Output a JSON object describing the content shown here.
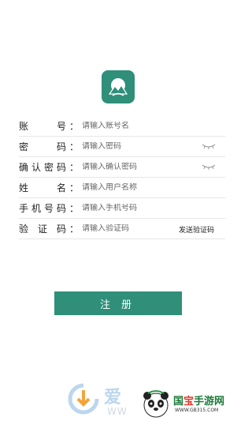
{
  "form": {
    "rows": [
      {
        "label_chars": [
          "账",
          "号"
        ],
        "colon": "：",
        "placeholder": "请输入账号名"
      },
      {
        "label_chars": [
          "密",
          "码"
        ],
        "colon": "：",
        "placeholder": "请输入密码"
      },
      {
        "label_chars": [
          "确",
          "认",
          "密",
          "码"
        ],
        "colon": "：",
        "placeholder": "请输入确认密码"
      },
      {
        "label_chars": [
          "姓",
          "名"
        ],
        "colon": "：",
        "placeholder": "请输入用户名称"
      },
      {
        "label_chars": [
          "手",
          "机",
          "号",
          "码"
        ],
        "colon": "：",
        "placeholder": "请输入手机号码"
      },
      {
        "label_chars": [
          "验",
          "证",
          "码"
        ],
        "colon": "：",
        "placeholder": "请输入验证码"
      }
    ],
    "send_code_label": "发送验证码"
  },
  "register_label": "注册",
  "watermark": {
    "ai": "爱",
    "ww": "WW",
    "brand_prefix": "国",
    "brand_bao": "宝",
    "brand_suffix": "手游网",
    "url": "WWW.GB315.COM"
  },
  "colors": {
    "accent": "#2f8f79"
  }
}
